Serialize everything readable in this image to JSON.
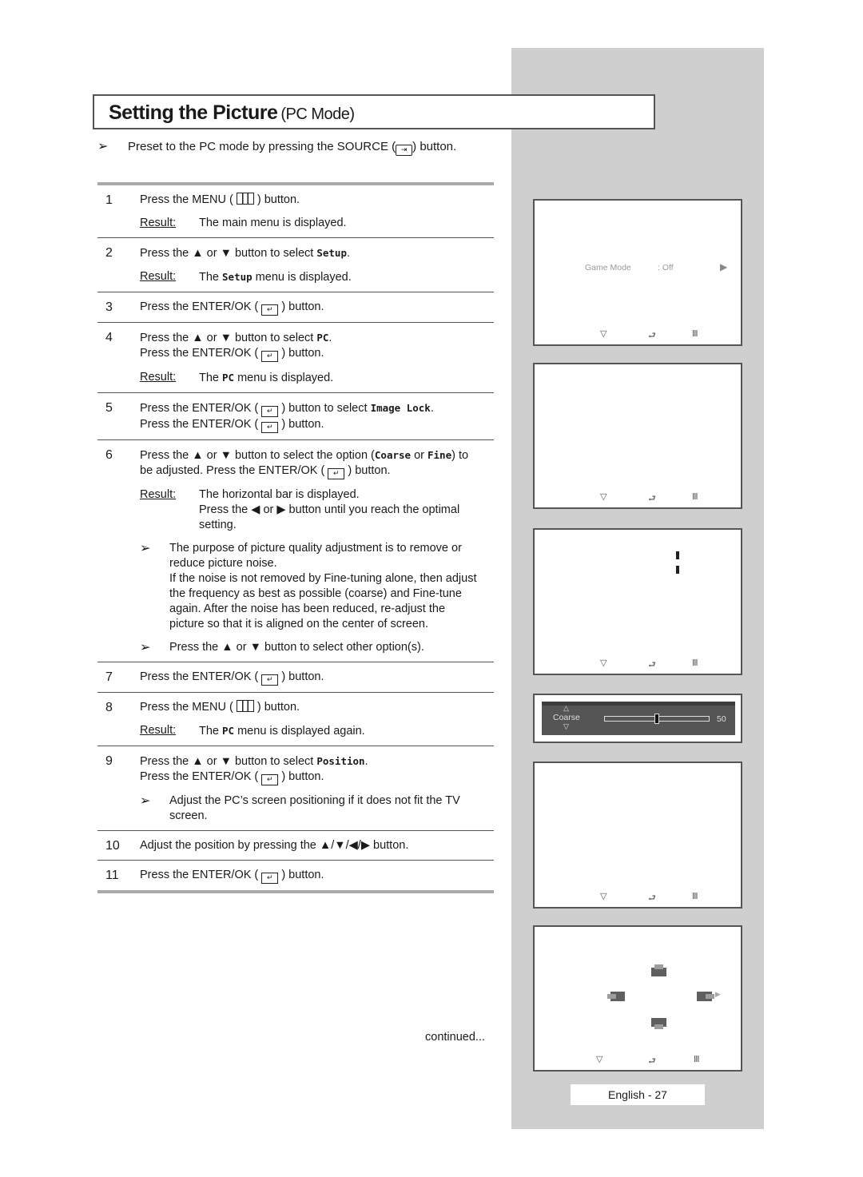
{
  "title": {
    "main": "Setting the Picture",
    "sub": "(PC Mode)"
  },
  "preset": {
    "arrow": "➢",
    "before": "Preset to the PC mode by pressing the SOURCE (",
    "icon": "source-icon",
    "after": ") button."
  },
  "result_label": "Result:",
  "steps": [
    {
      "num": "1",
      "lines": [
        "Press the MENU ( [menu] ) button."
      ],
      "result": [
        "The main menu is displayed."
      ]
    },
    {
      "num": "2",
      "lines": [
        "Press the ▲ or ▼ button to select {Setup}."
      ],
      "result": [
        "The {Setup} menu is displayed."
      ]
    },
    {
      "num": "3",
      "lines": [
        "Press the ENTER/OK ( [enter] ) button."
      ]
    },
    {
      "num": "4",
      "lines": [
        "Press the ▲ or ▼ button to select {PC}.",
        "Press the ENTER/OK ( [enter] ) button."
      ],
      "result": [
        "The {PC}  menu is displayed."
      ]
    },
    {
      "num": "5",
      "lines": [
        "Press the ENTER/OK ( [enter] ) button to select {Image Lock}.",
        "Press the ENTER/OK ( [enter] ) button."
      ]
    },
    {
      "num": "6",
      "lines": [
        "Press the ▲ or ▼ button to select the option ({Coarse} or {Fine}) to",
        "be adjusted. Press the ENTER/OK ( [enter] ) button."
      ],
      "result": [
        "The horizontal bar is displayed.",
        "Press the ◀ or ▶ button until you reach the optimal",
        "setting."
      ],
      "notes": [
        [
          "The purpose of picture quality adjustment is to remove or",
          "reduce picture noise.",
          "If the noise is not removed by Fine-tuning alone, then adjust",
          "the frequency as best as possible (coarse) and Fine-tune",
          "again. After the noise has been reduced, re-adjust the",
          "picture so that it is aligned on the center of screen."
        ],
        [
          "Press the ▲ or ▼ button to select other option(s)."
        ]
      ]
    },
    {
      "num": "7",
      "lines": [
        "Press the ENTER/OK ( [enter] ) button."
      ]
    },
    {
      "num": "8",
      "lines": [
        "Press the MENU ( [menu] ) button."
      ],
      "result": [
        "The {PC}  menu is displayed again."
      ]
    },
    {
      "num": "9",
      "lines": [
        "Press the ▲ or ▼ button to select {Position}.",
        "Press the ENTER/OK ( [enter] ) button."
      ],
      "notes": [
        [
          "Adjust the PC’s screen positioning if it does not fit the TV",
          "screen."
        ]
      ]
    },
    {
      "num": "10",
      "lines": [
        "Adjust the position by pressing the ▲/▼/◀/▶ button."
      ]
    },
    {
      "num": "11",
      "lines": [
        "Press the ENTER/OK ( [enter] ) button."
      ]
    }
  ],
  "note_arrow": "➢",
  "continued": "continued...",
  "screens": {
    "setup": {
      "item_label": "Game Mode",
      "item_value": ": Off",
      "arrow": "▶"
    },
    "bottom_icons": {
      "move": "▽",
      "enter": "⮐",
      "menu": "Ⅲ"
    },
    "coarse": {
      "label": "Coarse",
      "value": "50",
      "level_fraction": 0.5,
      "up": "△",
      "down": "▽"
    }
  },
  "page_number": "English - 27"
}
